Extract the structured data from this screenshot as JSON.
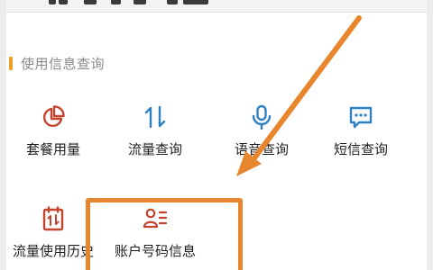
{
  "section": {
    "title": "使用信息查询"
  },
  "items": [
    {
      "label": "套餐用量",
      "icon": "pie-chart-icon"
    },
    {
      "label": "流量查询",
      "icon": "up-down-arrows-icon"
    },
    {
      "label": "语音查询",
      "icon": "microphone-icon"
    },
    {
      "label": "短信查询",
      "icon": "message-icon"
    },
    {
      "label": "流量使用历史",
      "icon": "calendar-arrows-icon"
    },
    {
      "label": "账户号码信息",
      "icon": "user-list-icon"
    }
  ],
  "colors": {
    "icon_red": "#c4442f",
    "icon_blue": "#2f7fc4",
    "accent_orange": "#e8862e",
    "section_accent": "#f0a02a"
  }
}
